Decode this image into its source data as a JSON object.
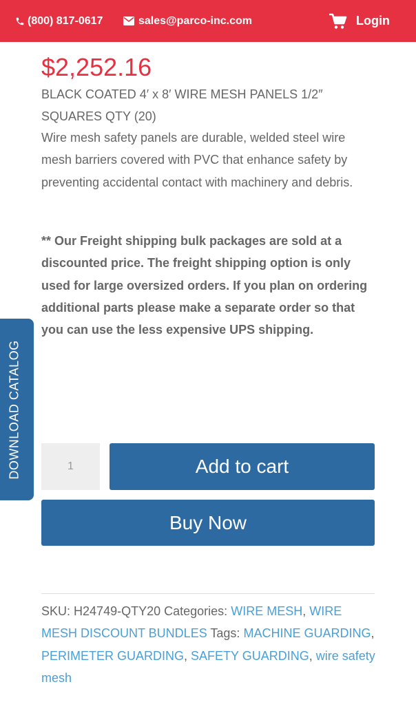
{
  "header": {
    "phone": "(800) 817-0617",
    "email": "sales@parco-inc.com",
    "login": "Login",
    "bg_color": "#e53141"
  },
  "product": {
    "price": "$2,252.16",
    "title": "BLACK COATED 4′ x 8′ WIRE MESH PANELS 1/2″ SQUARES QTY (20)",
    "description": "Wire mesh safety panels are durable, welded steel wire mesh barriers covered with PVC that enhance safety by preventing accidental contact with machinery and debris.",
    "note": "** Our Freight shipping bulk packages are sold at a discounted price. The freight shipping option is only used for large oversized orders. If you plan on ordering additional parts please make a separate order so that you can use the less expensive UPS shipping.",
    "quantity": "1",
    "add_to_cart": "Add to cart",
    "buy_now": "Buy Now"
  },
  "side_tab": {
    "label": "DOWNLOAD CATALOG"
  },
  "meta": {
    "sku_label": "SKU:",
    "sku": "H24749-QTY20",
    "categories_label": "Categories:",
    "categories": [
      "WIRE MESH",
      "WIRE MESH DISCOUNT BUNDLES"
    ],
    "tags_label": "Tags:",
    "tags": [
      "MACHINE GUARDING",
      "PERIMETER GUARDING",
      "SAFETY GUARDING",
      "wire safety mesh"
    ]
  },
  "colors": {
    "accent_red": "#e53141",
    "button_blue": "#2d6aa1",
    "link_blue": "#4a9fd6",
    "body_text": "#666666"
  }
}
